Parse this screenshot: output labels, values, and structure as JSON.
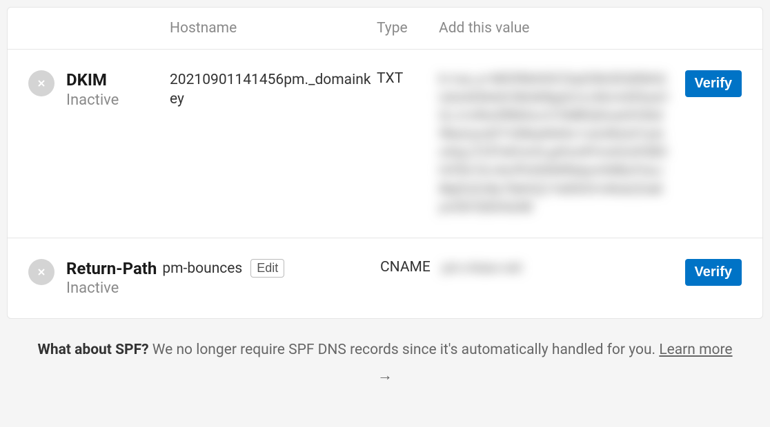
{
  "headers": {
    "hostname": "Hostname",
    "type": "Type",
    "value": "Add this value"
  },
  "records": {
    "dkim": {
      "name": "DKIM",
      "status": "Inactive",
      "hostname": "20210901141456pm._domainkey",
      "type": "TXT",
      "value_placeholder": "k=rsa; p=MIGfMA0GCSqGSIb3DQEBAQUAA4GNADCBiQKBgQCrLHiExVd55zd/IQ/J/mRwSRMAocV/hMB3jXwaHH36d9NaVynQFYV8NaWi69c1veUtRzGt7yAioXqLj7Z4TeEUoOLgrKsn8YnckGs9i3B3tVFB+Ch/4mPhXWiNfNdynHWBcPcbJ8kjEQ2U8y78dHZj1YeRXXVvWob2OaKynO8/lQIDAQAB",
      "verify_label": "Verify"
    },
    "return_path": {
      "name": "Return-Path",
      "status": "Inactive",
      "hostname": "pm-bounces",
      "edit_label": "Edit",
      "type": "CNAME",
      "value_placeholder": "pm.mtasv.net",
      "verify_label": "Verify"
    }
  },
  "spf": {
    "bold": "What about SPF?",
    "text": " We no longer require SPF DNS records since it's automatically handled for you. ",
    "learn_more": "Learn more",
    "arrow": "→"
  }
}
